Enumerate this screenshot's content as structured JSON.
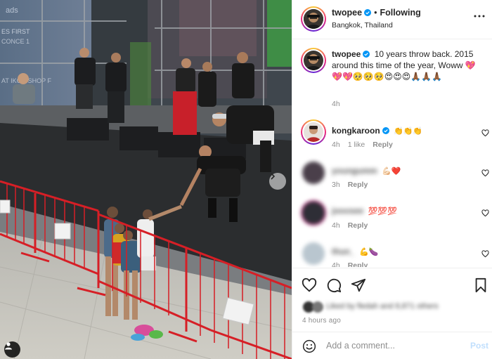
{
  "header": {
    "username": "twopee",
    "separator": "•",
    "follow_status": "Following",
    "location": "Bangkok, Thailand"
  },
  "caption": {
    "username": "twopee",
    "text": "10 years throw back. 2015 around this time of the year, Woww 💖💖💖🥺🥺🥺😍😍😍🙏🏾🙏🏾🙏🏾",
    "time": "4h"
  },
  "comments": [
    {
      "username": "kongkaroon",
      "verified": true,
      "text": "👏👏👏",
      "time": "4h",
      "likes": "1 like",
      "reply": "Reply",
      "name_blurred": false
    },
    {
      "username": "youngumm",
      "verified": false,
      "text": "💪🏻❤️",
      "time": "3h",
      "likes": "",
      "reply": "Reply",
      "name_blurred": true
    },
    {
      "username": "jooosee",
      "verified": false,
      "text": "💯💯💯",
      "time": "4h",
      "likes": "",
      "reply": "Reply",
      "name_blurred": true
    },
    {
      "username": "thun_",
      "verified": false,
      "text": "💪🍆",
      "time": "4h",
      "likes": "",
      "reply": "Reply",
      "name_blurred": true
    }
  ],
  "likes_summary": "Liked by fledah and 8,871 others",
  "time_ago": "4 hours ago",
  "add_comment": {
    "placeholder": "Add a comment...",
    "post_label": "Post"
  },
  "colors": {
    "verified_blue": "#0095f6",
    "post_disabled": "#c0dffd",
    "heart_red": "#ff3040"
  },
  "icons": {
    "more": "more-horizontal-icon",
    "like": "heart-icon",
    "comment": "comment-icon",
    "share": "send-icon",
    "save": "bookmark-icon",
    "emoji": "emoji-smile-icon",
    "next": "chevron-right-icon",
    "tag": "user-tag-icon"
  }
}
